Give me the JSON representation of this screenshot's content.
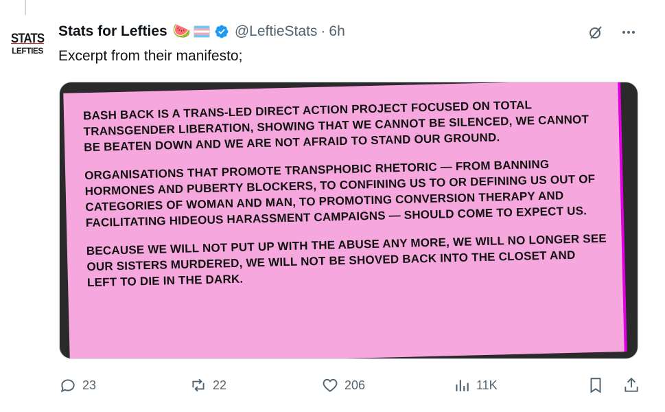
{
  "author": {
    "display_name": "Stats for Lefties",
    "emoji": "🍉",
    "handle": "@LeftieStats",
    "separator": "·",
    "time": "6h",
    "avatar_line1": "STATS",
    "avatar_line2": "LEFTIES"
  },
  "tweet": {
    "text": "Excerpt from their manifesto;"
  },
  "media": {
    "paragraphs": [
      "BASH BACK IS A TRANS-LED DIRECT ACTION PROJECT FOCUSED ON TOTAL TRANSGENDER LIBERATION, SHOWING THAT WE CANNOT BE SILENCED, WE CANNOT BE BEATEN DOWN AND WE ARE NOT AFRAID TO STAND OUR GROUND.",
      "ORGANISATIONS THAT PROMOTE TRANSPHOBIC RHETORIC — FROM BANNING HORMONES AND PUBERTY BLOCKERS, TO CONFINING US TO OR DEFINING US OUT OF CATEGORIES OF WOMAN AND MAN, TO PROMOTING CONVERSION THERAPY AND FACILITATING HIDEOUS HARASSMENT CAMPAIGNS — SHOULD COME TO EXPECT US.",
      "BECAUSE WE WILL NOT PUT UP WITH THE ABUSE ANY MORE, WE WILL NO LONGER SEE OUR SISTERS MURDERED, WE WILL NOT BE SHOVED BACK INTO THE CLOSET AND LEFT TO DIE IN THE DARK."
    ],
    "background_color": "#f6a8de"
  },
  "actions": {
    "replies": "23",
    "reposts": "22",
    "likes": "206",
    "views": "11K"
  },
  "icons": {
    "reply": "reply-icon",
    "repost": "repost-icon",
    "like": "heart-icon",
    "views": "views-icon",
    "bookmark": "bookmark-icon",
    "share": "share-icon",
    "grok": "grok-icon",
    "more": "more-icon",
    "verified": "verified-badge-icon"
  },
  "colors": {
    "text": "#0f1419",
    "muted": "#536471",
    "verified": "#1d9bf0"
  }
}
